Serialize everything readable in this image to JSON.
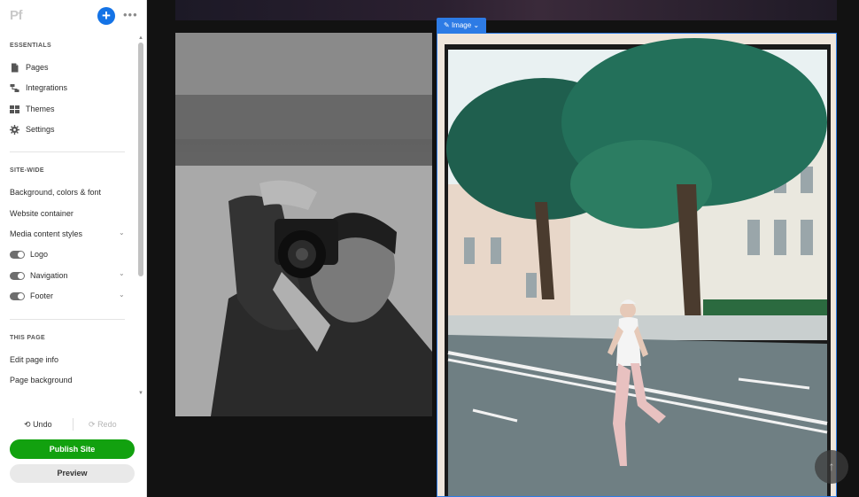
{
  "header": {
    "logo": "Pf",
    "add_label": "+",
    "more_label": "•••"
  },
  "sidebar": {
    "essentials": {
      "heading": "ESSENTIALS",
      "items": [
        {
          "label": "Pages",
          "icon": "page-icon"
        },
        {
          "label": "Integrations",
          "icon": "integrations-icon"
        },
        {
          "label": "Themes",
          "icon": "themes-icon"
        },
        {
          "label": "Settings",
          "icon": "gear-icon"
        }
      ]
    },
    "site_wide": {
      "heading": "SITE-WIDE",
      "items": [
        {
          "label": "Background, colors & font"
        },
        {
          "label": "Website container"
        },
        {
          "label": "Media content styles",
          "expandable": true
        }
      ],
      "toggles": [
        {
          "label": "Logo",
          "on": true,
          "expandable": false
        },
        {
          "label": "Navigation",
          "on": true,
          "expandable": true
        },
        {
          "label": "Footer",
          "on": true,
          "expandable": true
        }
      ]
    },
    "this_page": {
      "heading": "THIS PAGE",
      "items": [
        {
          "label": "Edit page info"
        },
        {
          "label": "Page background"
        }
      ]
    }
  },
  "footer": {
    "undo_label": "Undo",
    "redo_label": "Redo",
    "publish_label": "Publish Site",
    "preview_label": "Preview"
  },
  "canvas": {
    "image_tag_label": "Image",
    "left_photo": "black-and-white photographer with camera",
    "right_photo": "woman running across a city street under trees"
  },
  "colors": {
    "accent": "#1473e6",
    "publish": "#12a10f",
    "tag": "#2d7be5"
  }
}
